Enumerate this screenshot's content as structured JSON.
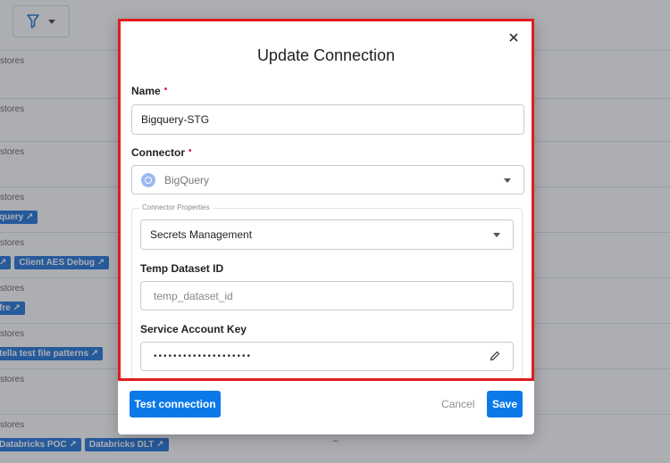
{
  "background": {
    "filter_icon": "filter-icon",
    "rows": [
      {
        "stores": "stores",
        "tags": []
      },
      {
        "stores": "stores",
        "tags": []
      },
      {
        "stores": "stores",
        "tags": []
      },
      {
        "stores": "stores",
        "tags": [
          "query ↗"
        ]
      },
      {
        "stores": "stores",
        "tags": [
          "↗",
          "Client AES Debug ↗"
        ]
      },
      {
        "stores": "stores",
        "tags": [
          "fre ↗"
        ]
      },
      {
        "stores": "stores",
        "tags": [
          "tella test file patterns ↗"
        ]
      },
      {
        "stores": "stores",
        "tags": []
      },
      {
        "stores": "stores",
        "tags": [
          "Databricks POC ↗",
          "Databricks DLT ↗"
        ]
      }
    ],
    "dash": "–"
  },
  "modal": {
    "title": "Update Connection",
    "close_icon": "close-icon",
    "name_label": "Name",
    "name_value": "Bigquery-STG",
    "connector_label": "Connector",
    "connector_value": "BigQuery",
    "connector_icon": "bigquery-icon",
    "required_mark": "•",
    "properties_legend": "Connector Properties",
    "secrets_value": "Secrets Management",
    "temp_dataset_label": "Temp Dataset ID",
    "temp_dataset_placeholder": "temp_dataset_id",
    "service_key_label": "Service Account Key",
    "service_key_value": "••••••••••••••••••••",
    "edit_icon": "pencil-icon"
  },
  "footer": {
    "test_label": "Test connection",
    "cancel_label": "Cancel",
    "save_label": "Save"
  },
  "colors": {
    "primary": "#0b79e8",
    "highlight_border": "#e21c1c",
    "required": "#e0164f"
  }
}
